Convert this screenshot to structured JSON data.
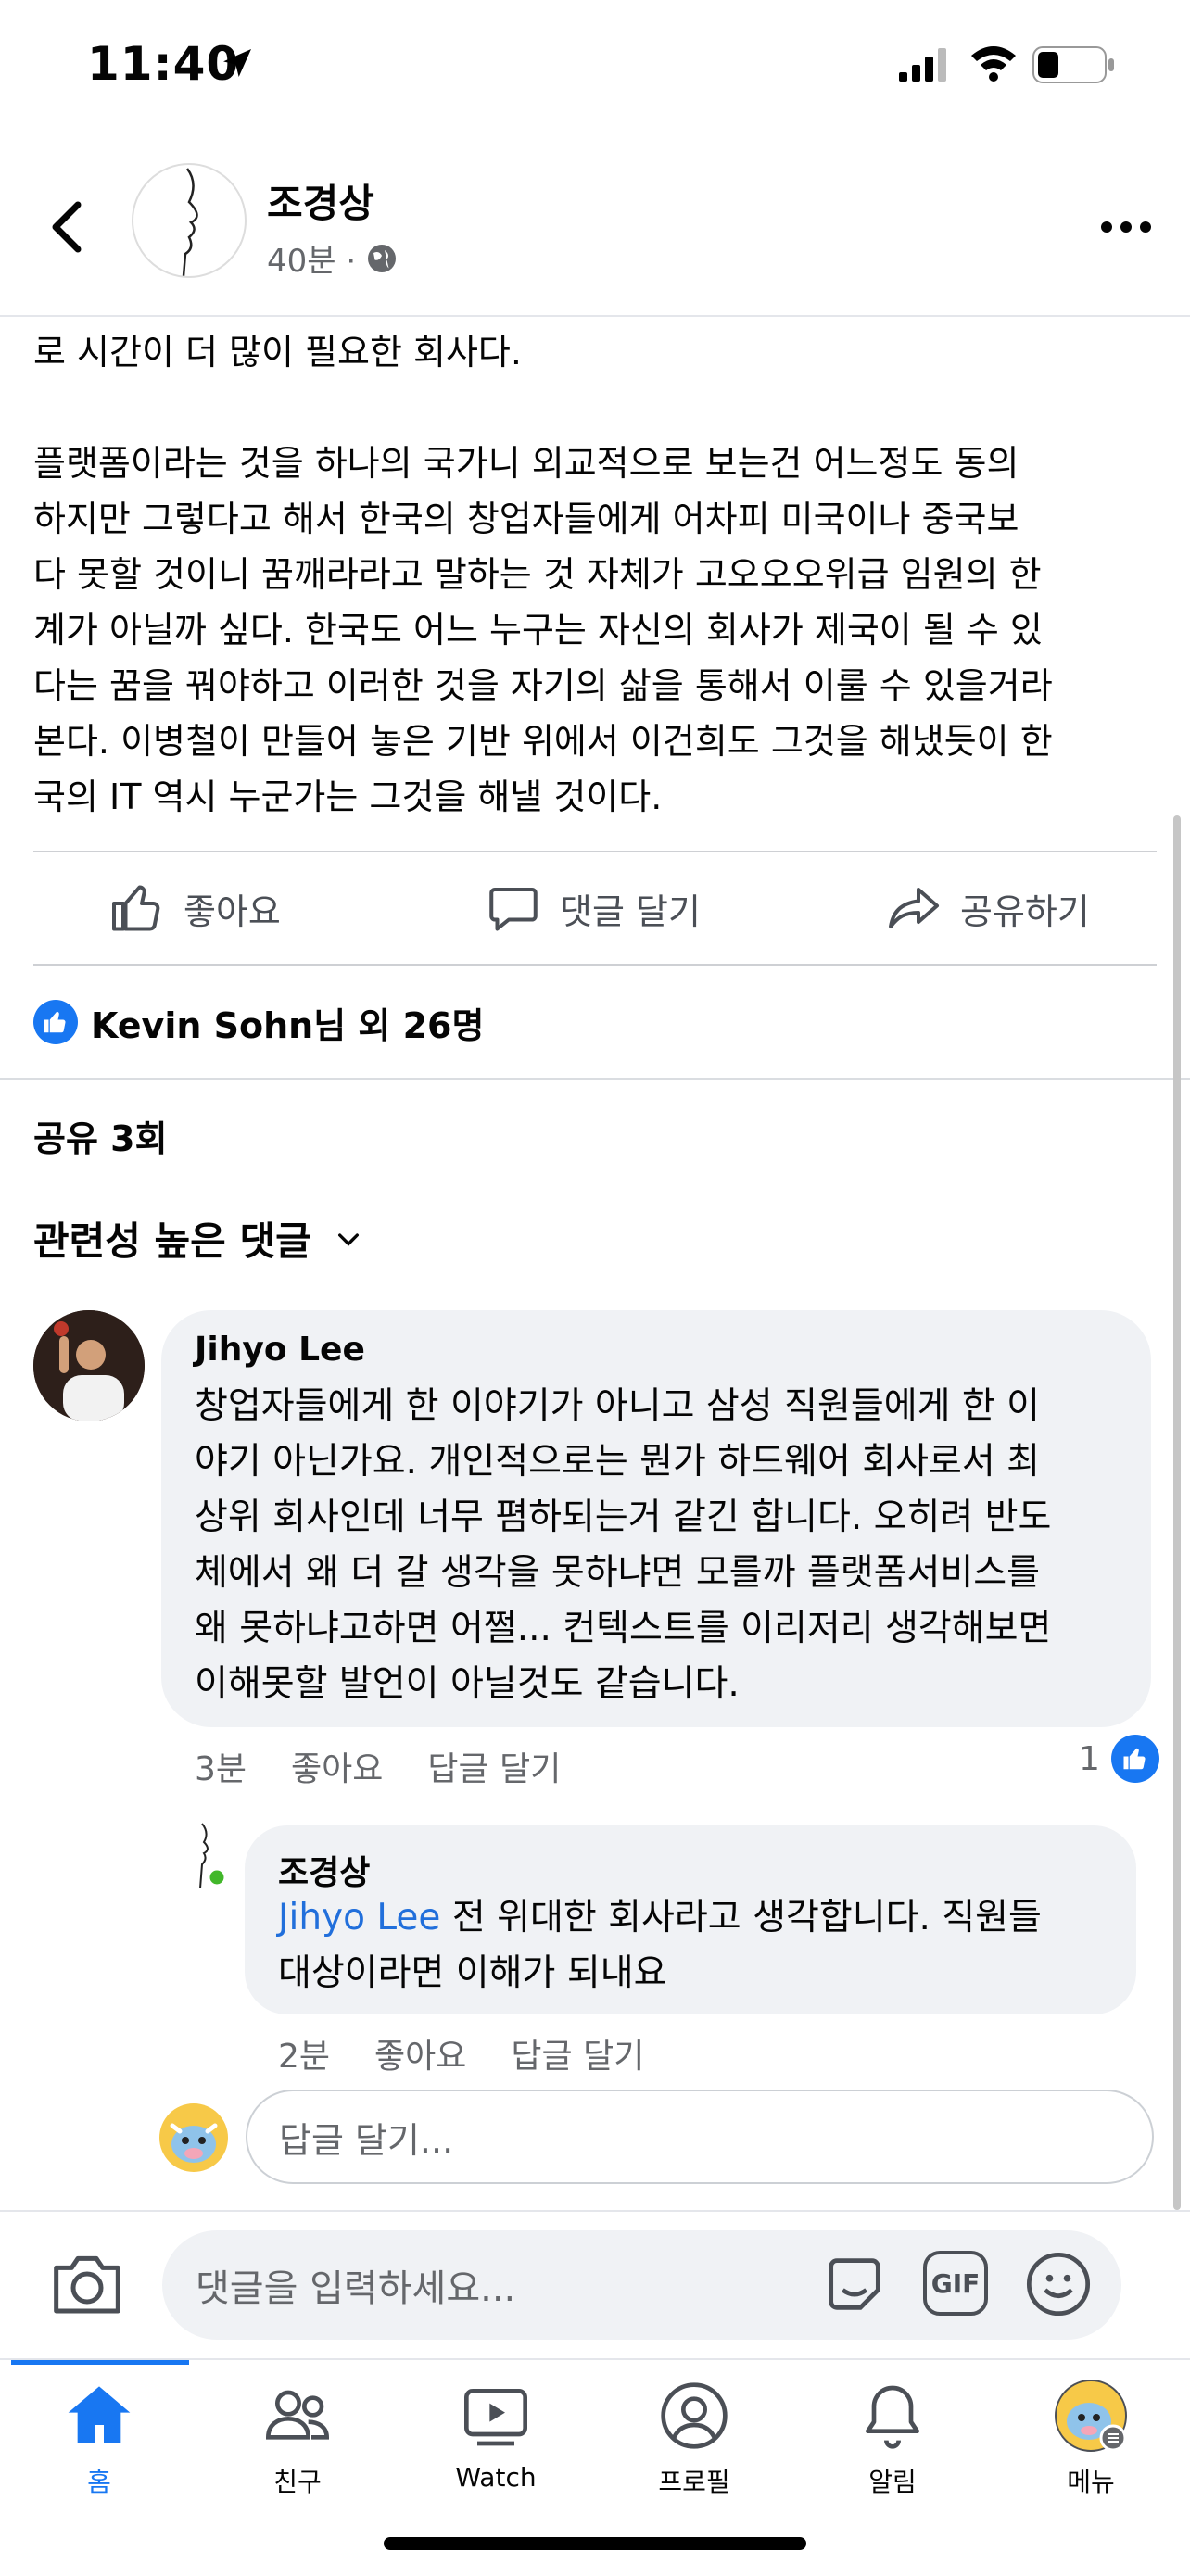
{
  "status_bar": {
    "time": "11:40"
  },
  "header": {
    "author": "조경상",
    "meta": "40분 ·"
  },
  "post": {
    "lines_top": "로 시간이 더 많이 필요한 회사다.",
    "paragraph": [
      "플랫폼이라는 것을 하나의 국가니 외교적으로 보는건 어느정도 동의",
      "하지만 그렇다고 해서 한국의 창업자들에게 어차피 미국이나 중국보",
      "다 못할 것이니 꿈깨라라고 말하는 것 자체가 고오오오위급 임원의 한",
      "계가 아닐까 싶다. 한국도 어느 누구는 자신의 회사가 제국이 될 수 있",
      "다는 꿈을 꿔야하고 이러한 것을 자기의 삶을 통해서 이룰 수 있을거라",
      "본다. 이병철이 만들어 놓은 기반 위에서 이건희도 그것을 해냈듯이 한",
      "국의 IT 역시 누군가는 그것을 해낼 것이다."
    ]
  },
  "actions": {
    "like": "좋아요",
    "comment": "댓글 달기",
    "share": "공유하기"
  },
  "reactions": {
    "summary": "Kevin Sohn님 외 26명"
  },
  "shares": "공유 3회",
  "sort_label": "관련성 높은 댓글",
  "comments": [
    {
      "name": "Jihyo Lee",
      "lines": [
        "창업자들에게 한 이야기가 아니고 삼성 직원들에게 한 이",
        "야기 아닌가요. 개인적으로는 뭔가 하드웨어 회사로서 최",
        "상위 회사인데 너무 폄하되는거 같긴 합니다. 오히려 반도",
        "체에서 왜 더 갈 생각을 못하냐면 모를까 플랫폼서비스를",
        "왜 못하냐고하면 어쩔... 컨텍스트를 이리저리 생각해보면",
        "이해못할 발언이 아닐것도 같습니다."
      ],
      "time": "3분",
      "like": "좋아요",
      "reply": "답글 달기",
      "like_count": "1"
    }
  ],
  "reply": {
    "name": "조경상",
    "mention": "Jihyo Lee",
    "line1_rest": " 전 위대한 회사라고 생각합니다. 직원들",
    "line2": "대상이라면 이해가 되내요",
    "time": "2분",
    "like": "좋아요",
    "reply": "답글 달기"
  },
  "reply_input": {
    "placeholder": "답글 달기..."
  },
  "composer": {
    "placeholder": "댓글을 입력하세요...",
    "gif": "GIF"
  },
  "tabs": [
    {
      "label": "홈",
      "icon": "home-icon"
    },
    {
      "label": "친구",
      "icon": "friends-icon"
    },
    {
      "label": "Watch",
      "icon": "watch-icon"
    },
    {
      "label": "프로필",
      "icon": "profile-icon"
    },
    {
      "label": "알림",
      "icon": "bell-icon"
    },
    {
      "label": "메뉴",
      "icon": "menu-avatar-icon"
    }
  ],
  "colors": {
    "accent": "#1877f2",
    "mention": "#216fdb",
    "bubble": "#f0f2f5",
    "meta": "#65676b"
  }
}
